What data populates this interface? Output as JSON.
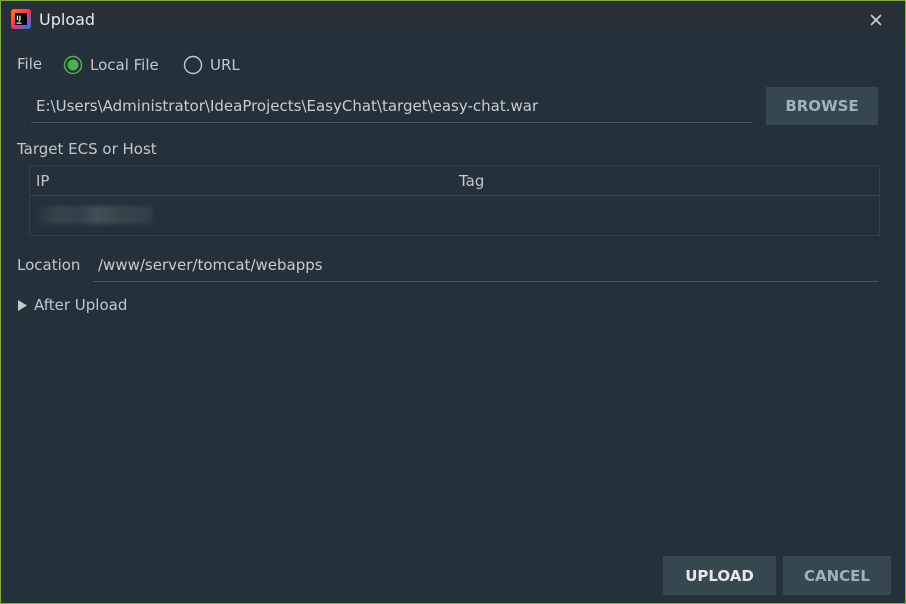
{
  "window": {
    "title": "Upload"
  },
  "file": {
    "label": "File",
    "options": [
      "Local File",
      "URL"
    ],
    "selected": "Local File",
    "path": "E:\\Users\\Administrator\\IdeaProjects\\EasyChat\\target\\easy-chat.war",
    "browse_label": "BROWSE"
  },
  "target": {
    "label": "Target ECS or Host",
    "columns": [
      "IP",
      "Tag"
    ]
  },
  "location": {
    "label": "Location",
    "value": "/www/server/tomcat/webapps"
  },
  "after_upload": {
    "label": "After Upload"
  },
  "footer": {
    "upload_label": "UPLOAD",
    "cancel_label": "CANCEL"
  },
  "colors": {
    "accent": "#4caf50",
    "border": "#7fae3b",
    "button_bg": "#37474f"
  }
}
